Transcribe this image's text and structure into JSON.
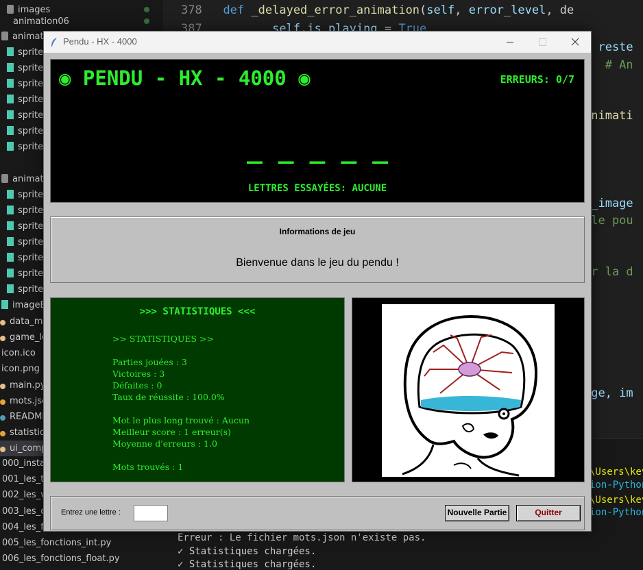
{
  "explorer": {
    "items": [
      {
        "label": "images"
      },
      {
        "label": "animation06"
      },
      {
        "label": "animati"
      },
      {
        "label": "sprite"
      },
      {
        "label": "sprite"
      },
      {
        "label": "sprite"
      },
      {
        "label": "sprite"
      },
      {
        "label": "sprite"
      },
      {
        "label": "sprite"
      },
      {
        "label": "sprite"
      },
      {
        "label": "animati"
      },
      {
        "label": "sprite"
      },
      {
        "label": "sprite"
      },
      {
        "label": "sprite"
      },
      {
        "label": "sprite"
      },
      {
        "label": "sprite"
      },
      {
        "label": "sprite"
      },
      {
        "label": "sprite"
      },
      {
        "label": "imageB"
      },
      {
        "label": "data_ma"
      },
      {
        "label": "game_lo"
      },
      {
        "label": "icon.ico"
      },
      {
        "label": "icon.png"
      },
      {
        "label": "main.py"
      },
      {
        "label": "mots.jso"
      },
      {
        "label": "READMI"
      },
      {
        "label": "statistiqu"
      },
      {
        "label": "ui_comp"
      },
      {
        "label": "000_instal"
      },
      {
        "label": "001_les_ty"
      },
      {
        "label": "002_les_va"
      },
      {
        "label": "003_les_co"
      },
      {
        "label": "004_les_fo"
      },
      {
        "label": "005_les_fonctions_int.py"
      },
      {
        "label": "006_les_fonctions_float.py"
      }
    ]
  },
  "editor": {
    "line1": {
      "num": "378",
      "kw": "def",
      "fn": "_delayed_error_animation",
      "rest_open": "(",
      "p1": "self",
      "sep": ", ",
      "p2": "error_level",
      "tail": ", de"
    },
    "line2": {
      "num": "387",
      "left": "self.is_playing",
      "eq": " = ",
      "val": "True"
    },
    "right_fragments": [
      {
        "text": "s reste",
        "cls": "pm"
      },
      {
        "text": ")  # An",
        "cls": "cm"
      },
      {
        "text": "animati",
        "cls": "fn"
      },
      {
        "text": "e_image",
        "cls": "pm"
      },
      {
        "text": "ale pou",
        "cls": "cm"
      },
      {
        "text": "ur la d",
        "cls": "cm"
      },
      {
        "text": "age, im",
        "cls": "pm"
      }
    ],
    "terminal": {
      "error_line": "Erreur : Le fichier mots.json n'existe pas.",
      "stats_line_1": "✓ Statistiques chargées.",
      "stats_line_2": "✓ Statistiques chargées.",
      "path_1": "\\Users\\kev",
      "path_1b": "ion-Python",
      "path_2": "\\Users\\kev",
      "path_2b": "ion-Python"
    }
  },
  "window": {
    "title": "Pendu - HX - 4000",
    "game": {
      "title": "◉ PENDU - HX - 4000 ◉",
      "errors": "ERREURS: 0/7",
      "word": "_ _ _ _ _",
      "tried_letters": "LETTRES ESSAYÉES: AUCUNE"
    },
    "info": {
      "title": "Informations de jeu",
      "message": "Bienvenue dans le jeu du pendu !"
    },
    "stats": {
      "heading": ">>> STATISTIQUES <<<",
      "lines": [
        ">> STATISTIQUES >>",
        "Parties jouées : 3",
        "Victoires : 3",
        "Défaites : 0",
        "Taux de réussite : 100.0%",
        "Mot le plus long trouvé : Aucun",
        "Meilleur score : 1 erreur(s)",
        "Moyenne d'erreurs : 1.0",
        "Mots trouvés : 1"
      ]
    },
    "input": {
      "label": "Entrez une lettre :",
      "value": "",
      "new_game": "Nouvelle Partie",
      "quit": "Quitter"
    }
  },
  "colors": {
    "terminal_green": "#2ded2d",
    "stats_bg": "#003a00",
    "quit_red": "#8b0000",
    "window_gray": "#c0c0c0"
  }
}
